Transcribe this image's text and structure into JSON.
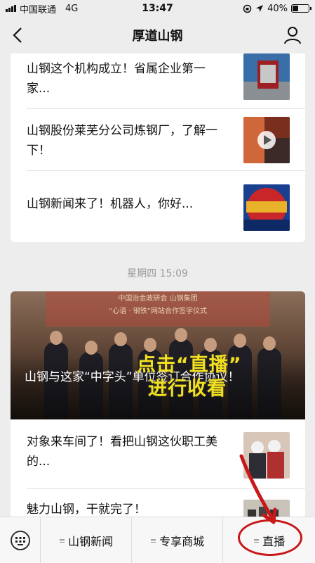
{
  "status_bar": {
    "carrier": "中国联通",
    "network": "4G",
    "time": "13:47",
    "battery": "40%",
    "battery_level": 0.4
  },
  "nav": {
    "title": "厚道山钢"
  },
  "articles_top": [
    {
      "title": "山钢这个机构成立！省属企业第一家..."
    },
    {
      "title": "山钢股份莱芜分公司炼钢厂，了解一下！"
    },
    {
      "title": "山钢新闻来了！机器人，你好..."
    }
  ],
  "timestamp": "星期四 15:09",
  "hero": {
    "banner_text_1": "中国治金政研会 山钢集团",
    "banner_text_2": "“心语 · 钢铁”网站合作签字仪式",
    "title": "山钢与这家“中字头”单位签订合作协议！",
    "overlay_line1": "点击“直播”",
    "overlay_line2": "进行收看"
  },
  "articles_bottom": [
    {
      "title": "对象来车间了！看把山钢这伙职工美的..."
    },
    {
      "title": "魅力山钢，干就完了！"
    }
  ],
  "menu": [
    {
      "label": "山钢新闻"
    },
    {
      "label": "专享商城"
    },
    {
      "label": "直播"
    }
  ],
  "colors": {
    "accent_red": "#c8181a",
    "overlay_yellow": "#f2e01e"
  }
}
